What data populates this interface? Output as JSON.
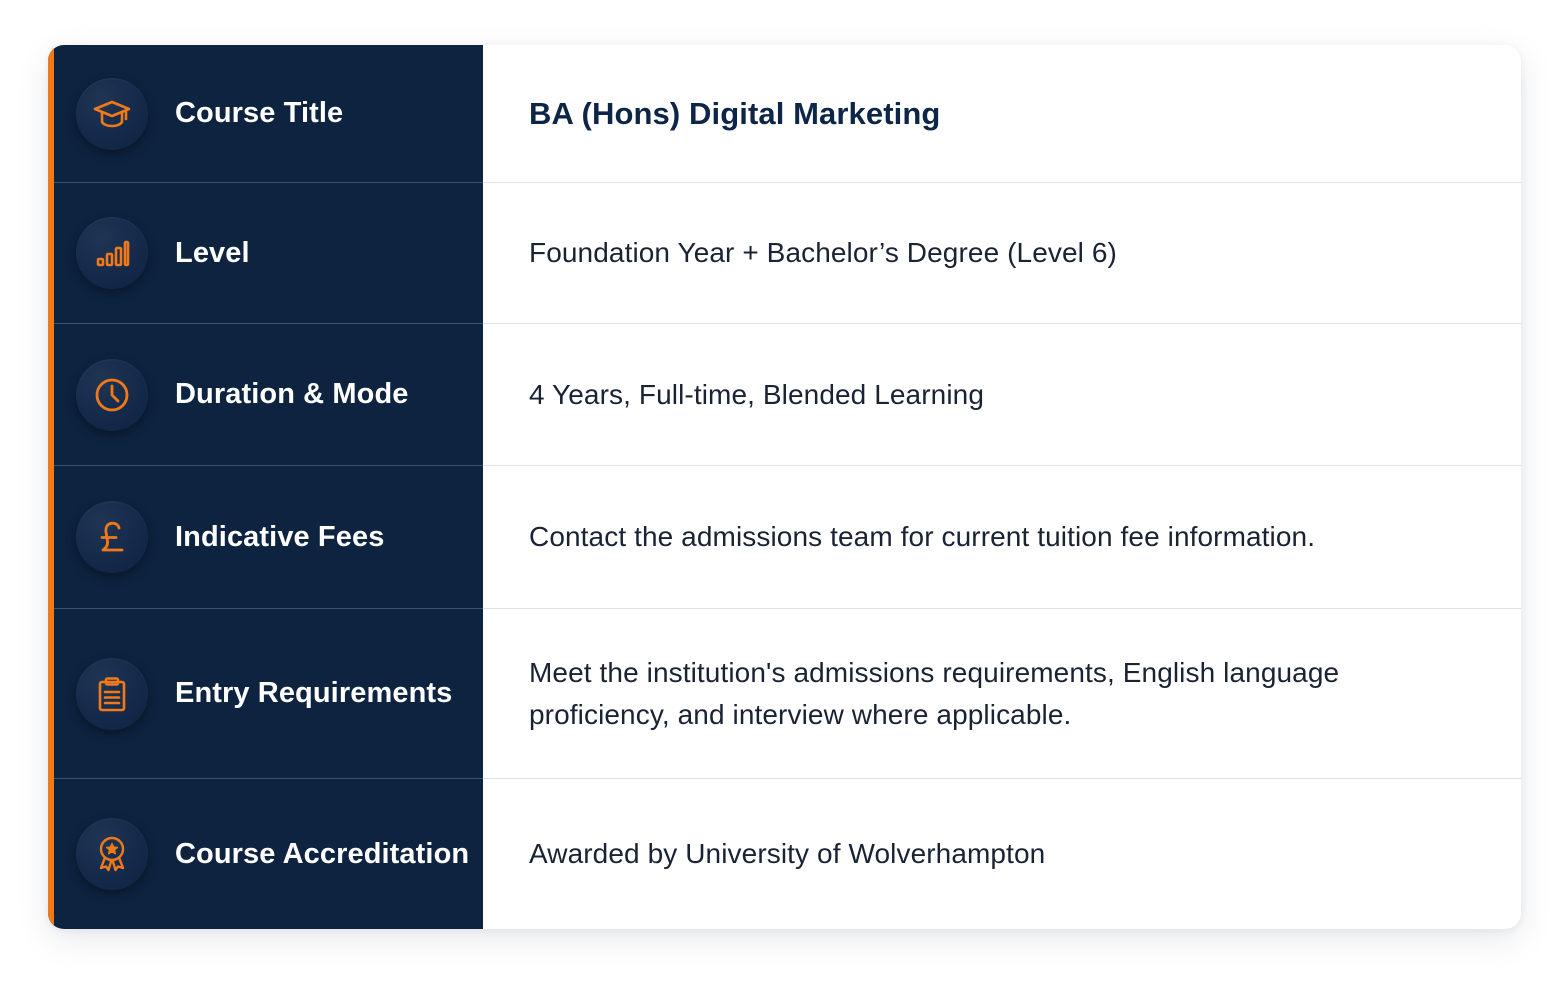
{
  "colors": {
    "navy": "#0d2340",
    "accent_orange": "#f07a1a",
    "title_text": "#0d2647",
    "body_text": "#1a2333"
  },
  "rows": [
    {
      "icon": "graduation-cap-icon",
      "label": "Course Title",
      "value": "BA (Hons) Digital Marketing"
    },
    {
      "icon": "bar-chart-icon",
      "label": "Level",
      "value": "Foundation Year + Bachelor’s Degree (Level 6)"
    },
    {
      "icon": "clock-icon",
      "label": "Duration & Mode",
      "value": "4 Years, Full-time, Blended Learning"
    },
    {
      "icon": "pound-icon",
      "label": "Indicative Fees",
      "value": "Contact the admissions team for current tuition fee information."
    },
    {
      "icon": "clipboard-icon",
      "label": "Entry Requirements",
      "value": "Meet the institution's admissions requirements, English language proficiency, and interview where applicable."
    },
    {
      "icon": "award-ribbon-icon",
      "label": "Course Accreditation",
      "value": "Awarded by University of Wolverhampton"
    }
  ]
}
